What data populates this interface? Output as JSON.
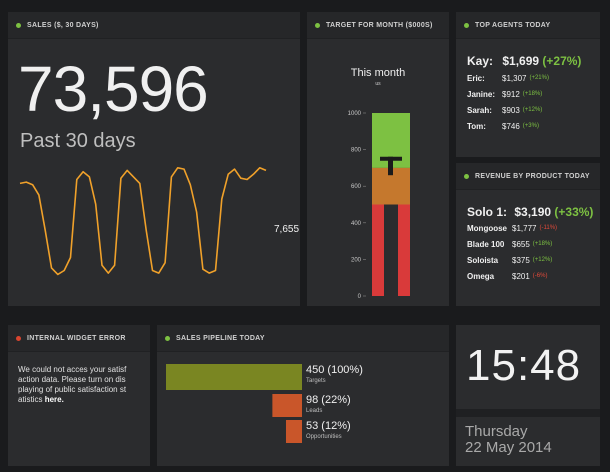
{
  "sales": {
    "header": "SALES ($, 30 DAYS)",
    "value": "73,596",
    "subtitle": "Past 30 days",
    "side_value": "7,655",
    "line_color": "#f0a12a"
  },
  "target": {
    "header": "TARGET FOR MONTH ($000S)",
    "title": "This month",
    "subtitle": "us",
    "axis_ticks": [
      "1000",
      "800",
      "600",
      "400",
      "200",
      "0"
    ],
    "bands": {
      "green_from": 700,
      "orange_from": 500,
      "max": 1000
    },
    "actual": 500,
    "target_marker": 750,
    "colors": {
      "green": "#7dc142",
      "orange": "#c5782d",
      "red": "#d93a3a",
      "marker": "#1b1b1b"
    }
  },
  "agents": {
    "header": "TOP AGENTS TODAY",
    "leader": {
      "name": "Kay:",
      "value": "$1,699",
      "change": "(+27%)"
    },
    "rows": [
      {
        "name": "Eric:",
        "value": "$1,307",
        "change": "(+21%)",
        "dir": "up"
      },
      {
        "name": "Janine:",
        "value": "$912",
        "change": "(+18%)",
        "dir": "up"
      },
      {
        "name": "Sarah:",
        "value": "$903",
        "change": "(+12%)",
        "dir": "up"
      },
      {
        "name": "Tom:",
        "value": "$746",
        "change": "(+3%)",
        "dir": "up"
      }
    ]
  },
  "revenue": {
    "header": "REVENUE BY PRODUCT TODAY",
    "leader": {
      "name": "Solo 1:",
      "value": "$3,190",
      "change": "(+33%)"
    },
    "rows": [
      {
        "name": "Mongoose",
        "value": "$1,777",
        "change": "(-11%)",
        "dir": "down"
      },
      {
        "name": "Blade 100",
        "value": "$655",
        "change": "(+18%)",
        "dir": "up"
      },
      {
        "name": "Soloista",
        "value": "$375",
        "change": "(+12%)",
        "dir": "up"
      },
      {
        "name": "Omega",
        "value": "$201",
        "change": "(-6%)",
        "dir": "down"
      }
    ]
  },
  "error": {
    "header": "INTERNAL WIDGET ERROR",
    "text": "We could not acces your satisf action data. Please turn on dis playing of public satisfaction st atistics",
    "link": "here."
  },
  "pipeline": {
    "header": "SALES PIPELINE TODAY",
    "stages": [
      {
        "value": "450 (100%)",
        "label": "Targets",
        "count": 450,
        "color": "#7a8622"
      },
      {
        "value": "98 (22%)",
        "label": "Leads",
        "count": 98,
        "color": "#c9562a"
      },
      {
        "value": "53 (12%)",
        "label": "Opportunities",
        "count": 53,
        "color": "#c9562a"
      }
    ]
  },
  "clock": {
    "time": "15:48",
    "day": "Thursday",
    "date": "22 May 2014"
  },
  "chart_data": {
    "type": "line",
    "title": "",
    "xlabel": "",
    "ylabel": "",
    "x": [
      1,
      2,
      3,
      4,
      5,
      6,
      7,
      8,
      9,
      10,
      11,
      12,
      13,
      14,
      15,
      16,
      17,
      18,
      19,
      20,
      21,
      22,
      23,
      24,
      25,
      26,
      27,
      28,
      29,
      30,
      31,
      32,
      33,
      34,
      35,
      36,
      37,
      38,
      39,
      40
    ],
    "values": [
      8200,
      8300,
      8100,
      7300,
      4600,
      1700,
      1200,
      1500,
      2500,
      8500,
      9100,
      8700,
      6600,
      1900,
      1300,
      1900,
      8600,
      9200,
      8700,
      8200,
      4600,
      1500,
      1300,
      2100,
      8700,
      9400,
      9300,
      8100,
      6000,
      1600,
      1300,
      1500,
      7000,
      8900,
      9300,
      8600,
      8500,
      8900,
      9400,
      9200
    ],
    "ylim": [
      0,
      10000
    ],
    "color": "#f0a12a"
  }
}
